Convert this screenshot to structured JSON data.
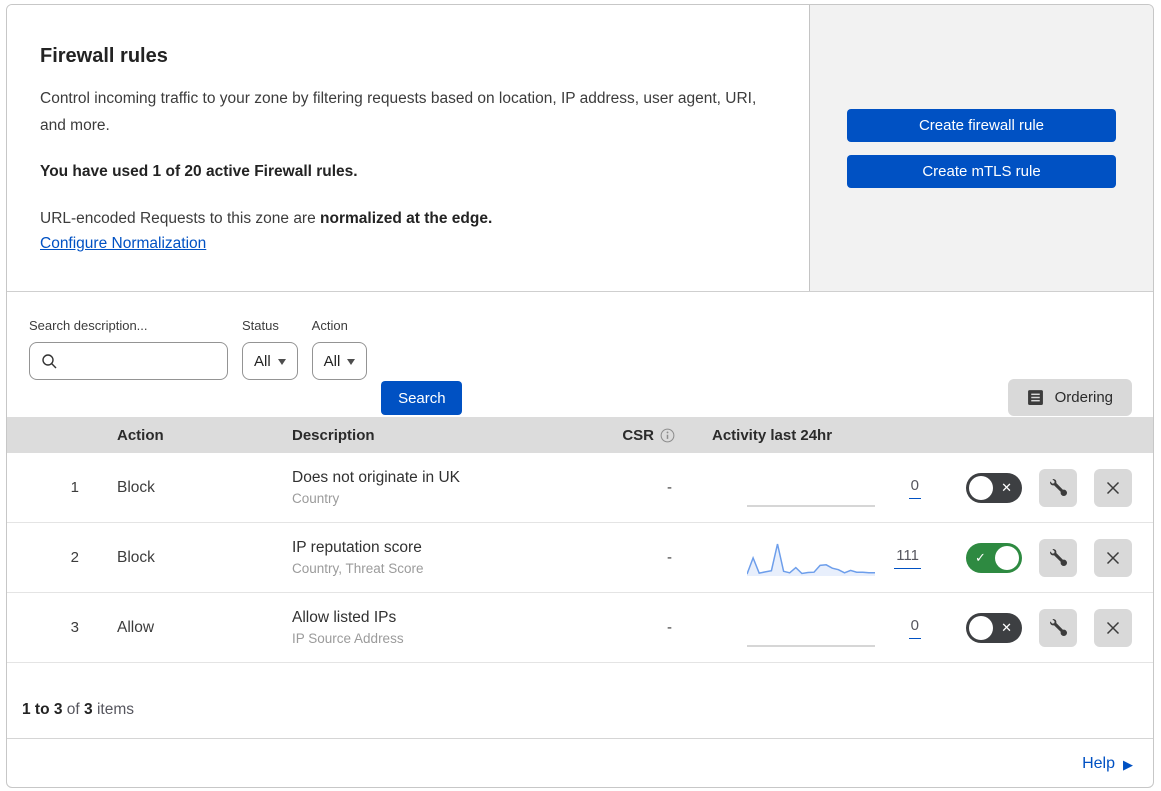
{
  "header": {
    "title": "Firewall rules",
    "description": "Control incoming traffic to your zone by filtering requests based on location, IP address, user agent, URI, and more.",
    "usage": "You have used 1 of 20 active Firewall rules.",
    "normalization_text": "URL-encoded Requests to this zone are",
    "normalization_bold": "normalized at the edge.",
    "normalization_link": "Configure Normalization",
    "buttons": {
      "create_firewall": "Create firewall rule",
      "create_mtls": "Create mTLS rule"
    }
  },
  "filters": {
    "search_label": "Search description...",
    "status": {
      "label": "Status",
      "value": "All"
    },
    "action": {
      "label": "Action",
      "value": "All"
    },
    "search_button": "Search",
    "ordering_button": "Ordering"
  },
  "table": {
    "columns": {
      "action": "Action",
      "description": "Description",
      "csr": "CSR",
      "activity": "Activity last 24hr"
    },
    "rows": [
      {
        "index": "1",
        "action": "Block",
        "description": "Does not originate in UK",
        "criteria": "Country",
        "csr": "-",
        "count": "0",
        "enabled": false,
        "sparkline": []
      },
      {
        "index": "2",
        "action": "Block",
        "description": "IP reputation score",
        "criteria": "Country, Threat Score",
        "csr": "-",
        "count": "111",
        "enabled": true,
        "sparkline": [
          3,
          55,
          6,
          10,
          14,
          100,
          12,
          7,
          24,
          5,
          8,
          9,
          31,
          33,
          22,
          17,
          7,
          15,
          9,
          9,
          7,
          7
        ]
      },
      {
        "index": "3",
        "action": "Allow",
        "description": "Allow listed IPs",
        "criteria": "IP Source Address",
        "csr": "-",
        "count": "0",
        "enabled": false,
        "sparkline": []
      }
    ]
  },
  "footer": {
    "range": "1 to 3",
    "of": "of",
    "total": "3",
    "items": "items"
  },
  "help": {
    "label": "Help"
  },
  "colors": {
    "accent_blue": "#0051c3",
    "toggle_on": "#2e8a41",
    "toggle_off": "#3d3f42",
    "sparkline_blue": "#6d9eeb",
    "header_bg": "#dcdcdc",
    "panel_bg": "#f2f2f2"
  }
}
